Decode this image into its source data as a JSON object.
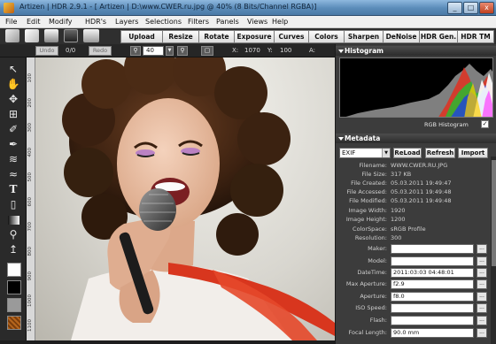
{
  "window": {
    "title": "Artizen | HDR 2.9.1 - [ Artizen | D:\\www.CWER.ru.jpg @ 40% (8 Bits/Channel RGBA)]",
    "minimize": "_",
    "maximize": "□",
    "close": "x"
  },
  "menu": [
    "File",
    "Edit",
    "Modify",
    "HDR's",
    "Layers",
    "Selections",
    "Filters",
    "Panels",
    "Views",
    "Help"
  ],
  "toolbar": {
    "buttons": [
      "Upload",
      "Resize",
      "Rotate",
      "Exposure",
      "Curves",
      "Colors",
      "Sharpen",
      "DeNoise",
      "HDR Gen.",
      "HDR TM"
    ]
  },
  "toolbar2": {
    "undo": "Undo",
    "undo_count": "0/0",
    "redo": "Redo",
    "zoom_value": "40",
    "x_label": "X:",
    "x_value": "1070",
    "y_label": "Y:",
    "y_value": "100",
    "a_label": "A:"
  },
  "ruler_ticks": [
    "100",
    "200",
    "300",
    "400",
    "500",
    "600",
    "700",
    "800",
    "900",
    "1000",
    "1100"
  ],
  "histogram": {
    "header": "Histogram",
    "label": "RGB Histogram",
    "checked": true
  },
  "metadata": {
    "header": "Metadata",
    "select_value": "EXIF",
    "reload": "ReLoad",
    "refresh": "Refresh",
    "import": "Import",
    "readonly_rows": [
      {
        "label": "Filename:",
        "value": "WWW.CWER.RU.JPG"
      },
      {
        "label": "File Size:",
        "value": "317 KB"
      },
      {
        "label": "File Created:",
        "value": "05.03.2011 19:49:47"
      },
      {
        "label": "File Accessed:",
        "value": "05.03.2011 19:49:48"
      },
      {
        "label": "File Modified:",
        "value": "05.03.2011 19:49:48"
      },
      {
        "label": "Image Width:",
        "value": "1920"
      },
      {
        "label": "Image Height:",
        "value": "1200"
      },
      {
        "label": "ColorSpace:",
        "value": "sRGB Profile"
      },
      {
        "label": "Resolution:",
        "value": "300"
      }
    ],
    "field_rows": [
      {
        "label": "Maker:",
        "value": ""
      },
      {
        "label": "Model:",
        "value": ""
      },
      {
        "label": "DateTime:",
        "value": "2011:03:03 04:48:01"
      },
      {
        "label": "Max Aperture:",
        "value": "f2.9"
      },
      {
        "label": "Aperture:",
        "value": "f8.0"
      },
      {
        "label": "ISO Speed:",
        "value": ""
      },
      {
        "label": "Flash:",
        "value": ""
      },
      {
        "label": "Focal Length:",
        "value": "90.0 mm"
      }
    ],
    "dots": "..."
  },
  "colors": {
    "title_bar": "#5a8bb8",
    "panel_bg": "#3c3c3c",
    "toolbar_bg": "#2f2f2f",
    "scarf": "#d8361e"
  },
  "icons": {
    "toolbar": [
      "pencil-icon",
      "eraser-icon",
      "open-icon",
      "save-icon",
      "print-icon"
    ],
    "palette": [
      "arrow-icon",
      "hand-icon",
      "move-icon",
      "crop-icon",
      "brush-icon",
      "pen-icon",
      "smudge-icon",
      "wave-icon",
      "text-icon",
      "stamp-icon",
      "gradient-icon",
      "magnifier-icon",
      "eyedropper-icon"
    ]
  }
}
